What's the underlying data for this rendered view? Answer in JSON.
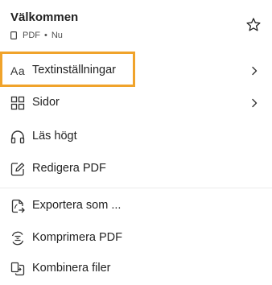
{
  "header": {
    "title": "Välkommen",
    "file_type": "PDF",
    "separator": "•",
    "timestamp": "Nu"
  },
  "menu": {
    "items": [
      {
        "label": "Textinställningar",
        "icon": "text-settings-icon",
        "has_chevron": true,
        "highlighted": true
      },
      {
        "label": "Sidor",
        "icon": "pages-grid-icon",
        "has_chevron": true
      },
      {
        "label": "Läs högt",
        "icon": "headphones-icon",
        "has_chevron": false
      },
      {
        "label": "Redigera PDF",
        "icon": "edit-pdf-icon",
        "has_chevron": false
      },
      {
        "label": "Exportera som ...",
        "icon": "export-icon",
        "has_chevron": false
      },
      {
        "label": "Komprimera PDF",
        "icon": "compress-icon",
        "has_chevron": false
      },
      {
        "label": "Kombinera filer",
        "icon": "combine-files-icon",
        "has_chevron": false
      }
    ]
  },
  "text_icon_glyph": "Aa",
  "colors": {
    "highlight_border": "#f0a32b",
    "text": "#222222",
    "muted_text": "#505050"
  }
}
